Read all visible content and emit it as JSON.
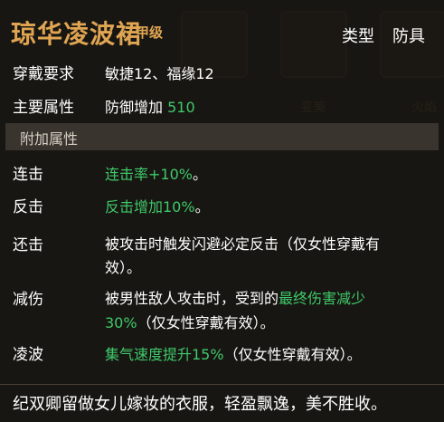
{
  "item": {
    "name": "琼华凌波裙",
    "grade": "甲级",
    "type_label": "类型",
    "type_value": "防具"
  },
  "requirements": {
    "label": "穿戴要求",
    "value": "敏捷12、福缘12"
  },
  "main_attribute": {
    "label": "主要属性",
    "name": "防御增加",
    "value": "510"
  },
  "extra_section": {
    "title": "附加属性"
  },
  "affixes": [
    {
      "label": "连击",
      "line1_green": "连击率+10%",
      "line1_white": "。"
    },
    {
      "label": "反击",
      "line1_green": "反击增加10%",
      "line1_white": "。"
    },
    {
      "label": "还击",
      "line1_white_a": "被攻击时触发闪避必定反击（仅女性穿戴有",
      "line2_white": "效）。"
    },
    {
      "label": "减伤",
      "line1_white_a": "被男性敌人攻击时，受到的",
      "line1_green": "最终伤害减少",
      "line2_green": "30%",
      "line2_white": "（仅女性穿戴有效）。"
    },
    {
      "label": "凌波",
      "line1_green": "集气速度提升15%",
      "line1_white": "（仅女性穿戴有效）。"
    }
  ],
  "description": "纪双卿留做女儿嫁妆的衣服，轻盈飘逸，美不胜收。",
  "background": {
    "slot_label_1": "变美",
    "slot_label_2": "火焰"
  },
  "colors": {
    "title": "#e0a552",
    "green_text": "#3fc96a",
    "panel_bg": "#181512"
  }
}
